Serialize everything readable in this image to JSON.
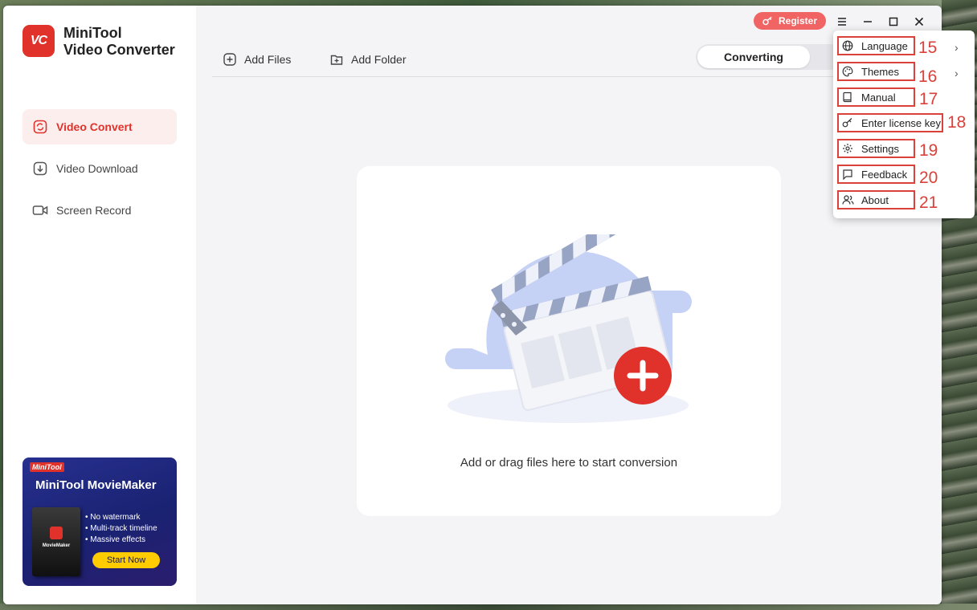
{
  "app": {
    "title_line1": "MiniTool",
    "title_line2": "Video Converter",
    "logo_text": "VC"
  },
  "sidebar": {
    "items": [
      {
        "label": "Video Convert",
        "icon": "convert-icon",
        "active": true
      },
      {
        "label": "Video Download",
        "icon": "download-icon",
        "active": false
      },
      {
        "label": "Screen Record",
        "icon": "camera-icon",
        "active": false
      }
    ]
  },
  "promo": {
    "brand": "MiniTool",
    "title": "MiniTool MovieMaker",
    "box_label": "MovieMaker",
    "features": [
      "No watermark",
      "Multi-track timeline",
      "Massive effects"
    ],
    "button": "Start Now"
  },
  "toolbar": {
    "add_files": "Add Files",
    "add_folder": "Add Folder",
    "tab_converting": "Converting"
  },
  "header": {
    "register": "Register"
  },
  "main": {
    "drop_text": "Add or drag files here to start conversion"
  },
  "menu": {
    "items": [
      {
        "label": "Language",
        "number": "15",
        "has_submenu": true,
        "icon": "globe-icon"
      },
      {
        "label": "Themes",
        "number": "16",
        "has_submenu": true,
        "icon": "palette-icon"
      },
      {
        "label": "Manual",
        "number": "17",
        "has_submenu": false,
        "icon": "book-icon"
      },
      {
        "label": "Enter license key",
        "number": "18",
        "has_submenu": false,
        "icon": "key-icon"
      },
      {
        "label": "Settings",
        "number": "19",
        "has_submenu": false,
        "icon": "gear-icon"
      },
      {
        "label": "Feedback",
        "number": "20",
        "has_submenu": false,
        "icon": "chat-icon"
      },
      {
        "label": "About",
        "number": "21",
        "has_submenu": false,
        "icon": "users-icon"
      }
    ]
  },
  "colors": {
    "accent": "#e0322b",
    "register_bg": "#f06464",
    "annotation": "#d9413a",
    "promo_button": "#ffcc00"
  }
}
